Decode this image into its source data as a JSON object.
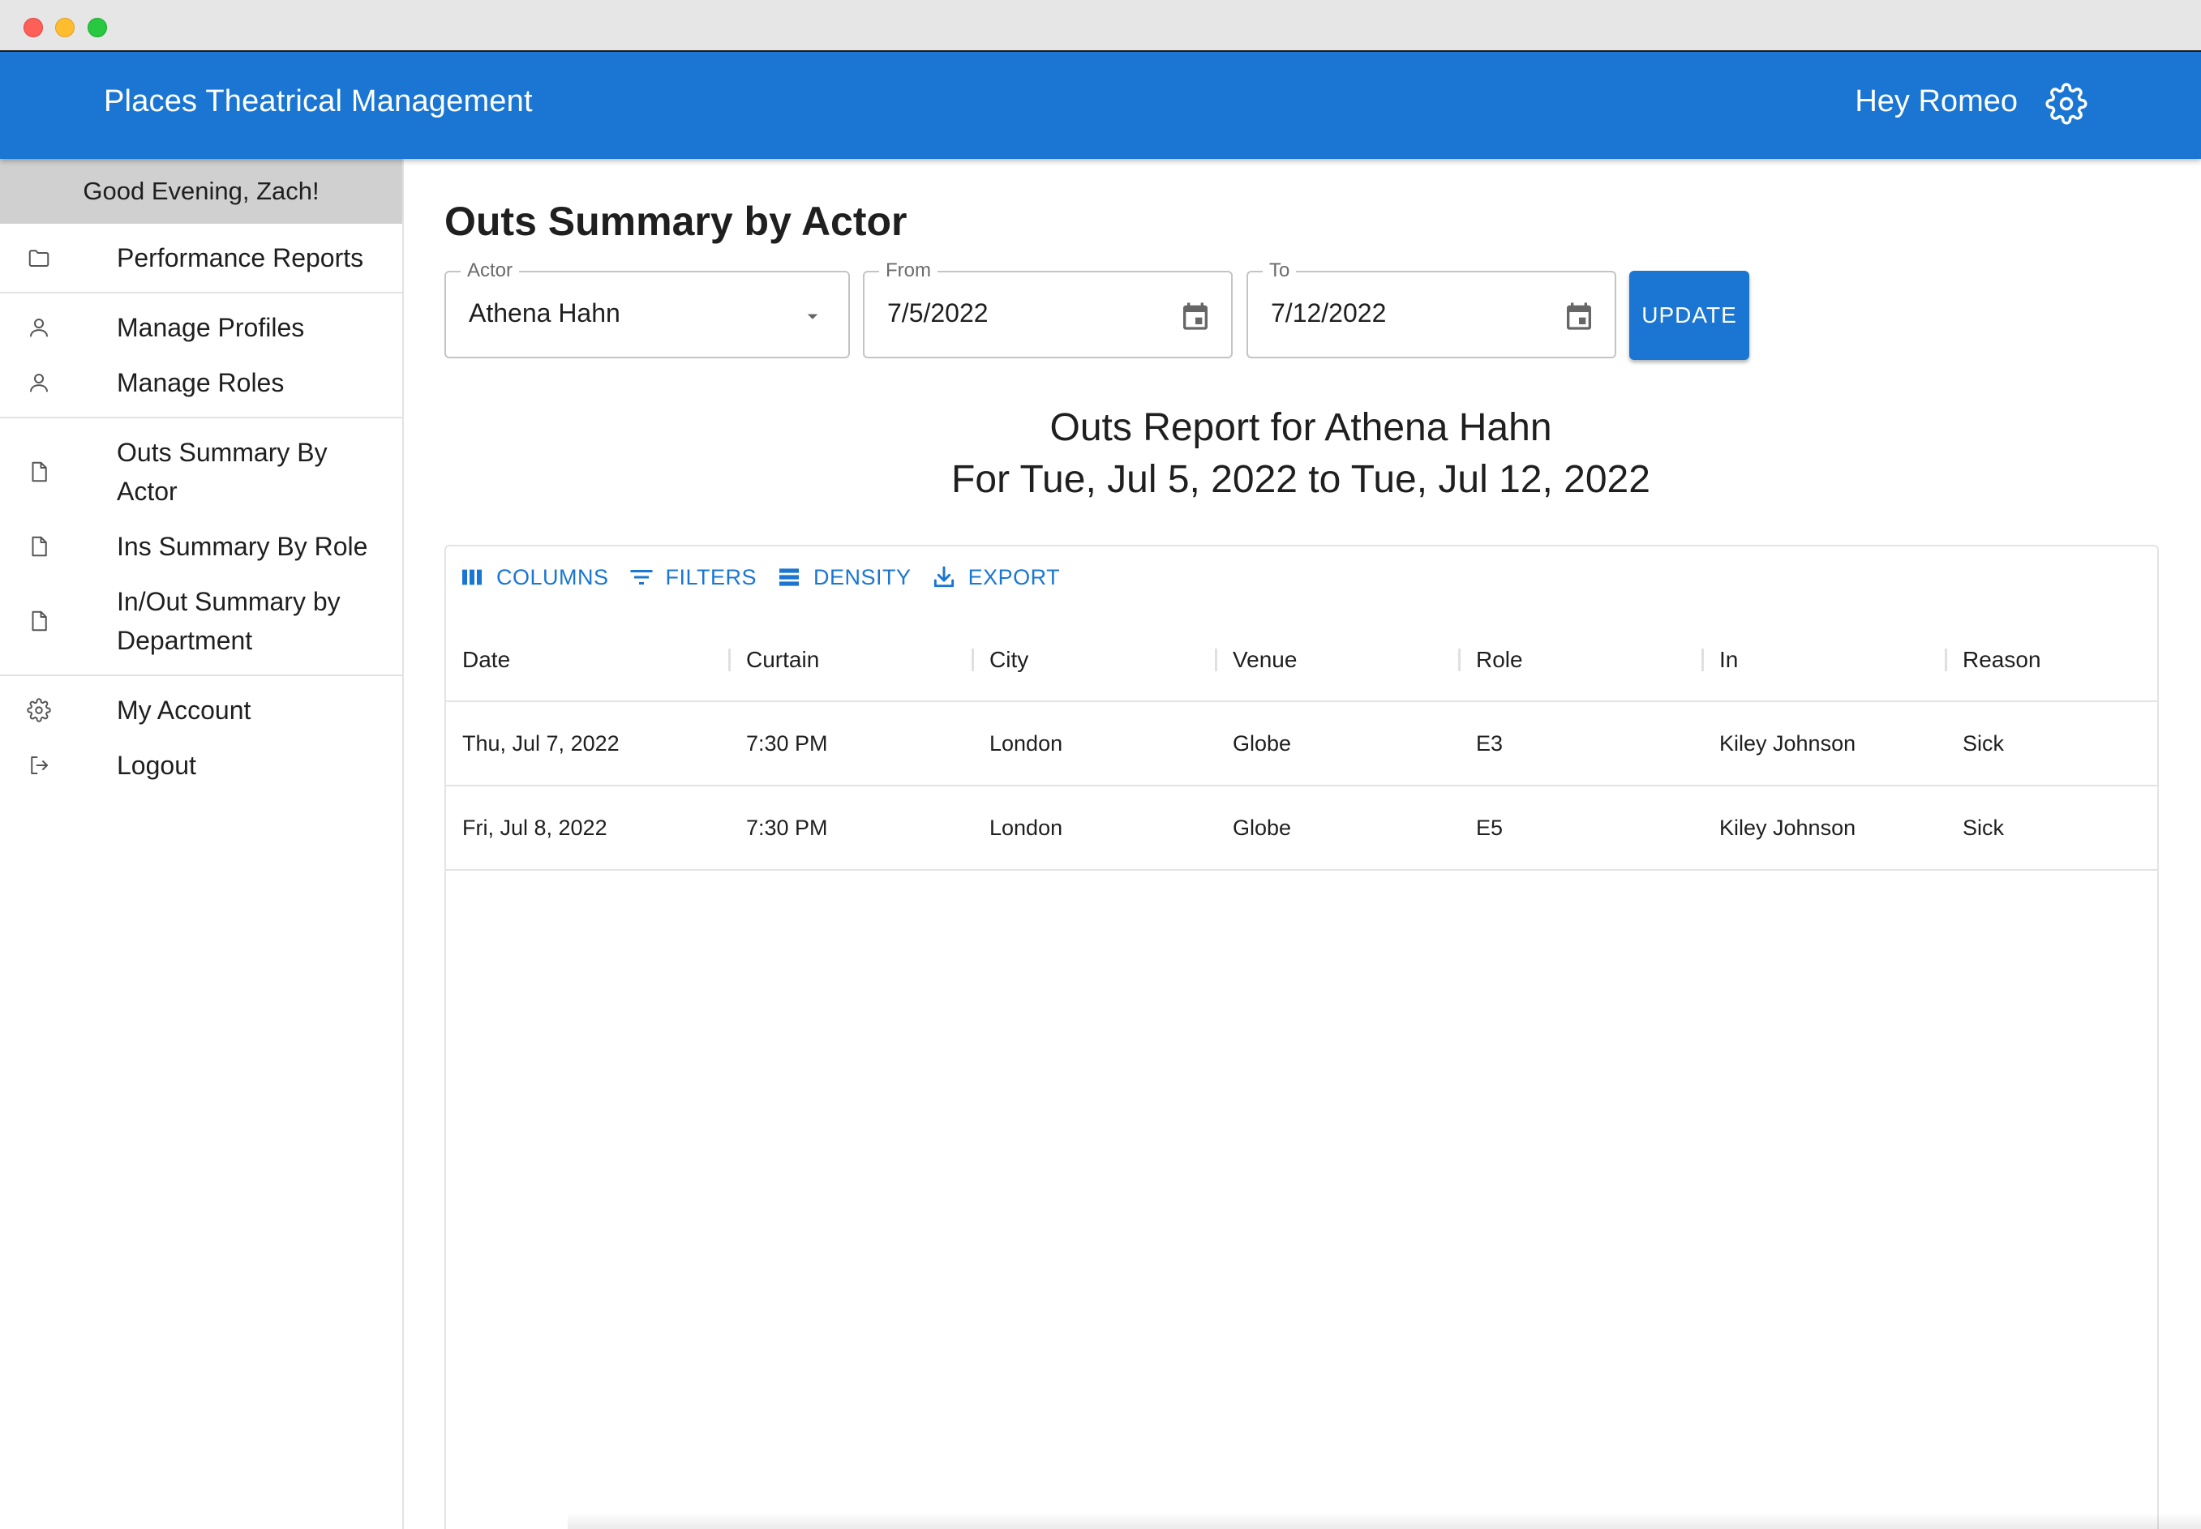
{
  "app": {
    "title": "Places Theatrical Management",
    "user_greeting": "Hey Romeo",
    "brand_color": "#1a76d2"
  },
  "sidebar": {
    "greeting": "Good Evening, Zach!",
    "groups": [
      {
        "items": [
          {
            "label": "Performance Reports",
            "icon": "folder-icon"
          }
        ]
      },
      {
        "items": [
          {
            "label": "Manage Profiles",
            "icon": "person-icon"
          },
          {
            "label": "Manage Roles",
            "icon": "person-icon"
          }
        ]
      },
      {
        "items": [
          {
            "label": "Outs Summary By Actor",
            "icon": "document-icon"
          },
          {
            "label": "Ins Summary By Role",
            "icon": "document-icon"
          },
          {
            "label": "In/Out Summary by Department",
            "icon": "document-icon"
          }
        ]
      },
      {
        "items": [
          {
            "label": "My Account",
            "icon": "gear-icon"
          },
          {
            "label": "Logout",
            "icon": "logout-icon"
          }
        ]
      }
    ]
  },
  "main": {
    "title": "Outs Summary by Actor",
    "filters": {
      "actor": {
        "label": "Actor",
        "value": "Athena Hahn"
      },
      "from": {
        "label": "From",
        "value": "7/5/2022"
      },
      "to": {
        "label": "To",
        "value": "7/12/2022"
      },
      "update_label": "UPDATE"
    },
    "report": {
      "line1": "Outs Report for Athena Hahn",
      "line2": "For Tue, Jul 5, 2022 to Tue, Jul 12, 2022"
    },
    "toolbar": {
      "columns": "COLUMNS",
      "filters": "FILTERS",
      "density": "DENSITY",
      "export": "EXPORT"
    },
    "table": {
      "columns": [
        "Date",
        "Curtain",
        "City",
        "Venue",
        "Role",
        "In",
        "Reason"
      ],
      "rows": [
        [
          "Thu, Jul 7, 2022",
          "7:30 PM",
          "London",
          "Globe",
          "E3",
          "Kiley Johnson",
          "Sick"
        ],
        [
          "Fri, Jul 8, 2022",
          "7:30 PM",
          "London",
          "Globe",
          "E5",
          "Kiley Johnson",
          "Sick"
        ]
      ]
    }
  }
}
